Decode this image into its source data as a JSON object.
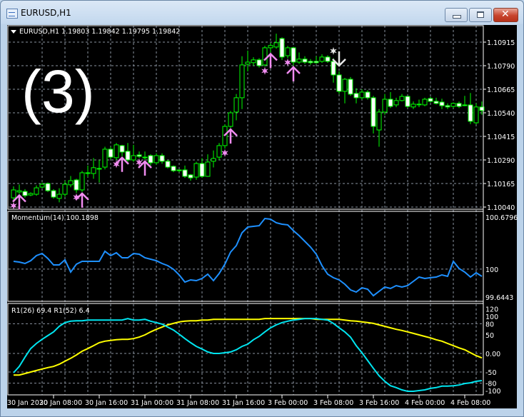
{
  "window": {
    "title": "EURUSD,H1",
    "buttons": {
      "minimize": "minimize",
      "maximize": "maximize",
      "close": "✕"
    }
  },
  "overlay_text": "(3)",
  "colors": {
    "background": "#000000",
    "candle_outline": "#00ff00",
    "bear_body": "#ffffff",
    "bull_body": "#000000",
    "grid": "#8a93a0",
    "signal_buy": "#f08cf0",
    "signal_sell": "#e8e8e8",
    "momentum": "#1e90ff",
    "r1_26": "#00e5f0",
    "r1_52": "#ffff00"
  },
  "chart_data": [
    {
      "type": "candlestick",
      "title": "EURUSD,H1  1.19803 1.19842 1.19795 1.19842",
      "y_ticks": [
        "1.10915",
        "1.10790",
        "1.10665",
        "1.10540",
        "1.10415",
        "1.10290",
        "1.10165",
        "1.10040"
      ],
      "ylim": [
        1.10015,
        1.1101
      ],
      "grid": true,
      "x_tick_labels": [
        "30 Jan 2020",
        "30 Jan 08:00",
        "30 Jan 16:00",
        "31 Jan 00:00",
        "31 Jan 08:00",
        "31 Jan 16:00",
        "3 Feb 00:00",
        "3 Feb 08:00",
        "3 Feb 16:00",
        "4 Feb 00:00",
        "4 Feb 08:00"
      ],
      "x_tick_bar_index": [
        -1,
        7,
        15,
        23,
        31,
        39,
        47,
        55,
        63,
        71,
        79
      ],
      "open": [
        1.10089,
        1.1012,
        1.10123,
        1.10104,
        1.10108,
        1.10146,
        1.10165,
        1.10127,
        1.10086,
        1.10108,
        1.10158,
        1.10184,
        1.10131,
        1.10222,
        1.10218,
        1.10245,
        1.10252,
        1.10347,
        1.10302,
        1.10366,
        1.10336,
        1.1029,
        1.10317,
        1.10305,
        1.10313,
        1.10275,
        1.10313,
        1.10283,
        1.10256,
        1.10237,
        1.10237,
        1.10211,
        1.10199,
        1.10271,
        1.10203,
        1.10283,
        1.10305,
        1.10366,
        1.10468,
        1.10544,
        1.1062,
        1.10798,
        1.10806,
        1.10821,
        1.10794,
        1.10885,
        1.10889,
        1.10934,
        1.10843,
        1.10885,
        1.10809,
        1.10825,
        1.10813,
        1.10813,
        1.10813,
        1.10836,
        1.10813,
        1.10741,
        1.10654,
        1.10718,
        1.10643,
        1.1062,
        1.1065,
        1.1062,
        1.10449,
        1.10544,
        1.10612,
        1.10582,
        1.10605,
        1.10627,
        1.10571,
        1.10586,
        1.10582,
        1.10616,
        1.10601,
        1.10597,
        1.10578,
        1.10574,
        1.1059,
        1.10582,
        1.10582,
        1.10487,
        1.10571
      ],
      "high": [
        1.1015,
        1.1016,
        1.10135,
        1.10118,
        1.10155,
        1.1017,
        1.1017,
        1.10135,
        1.1014,
        1.1018,
        1.10205,
        1.1019,
        1.10232,
        1.1026,
        1.103,
        1.1029,
        1.1036,
        1.1036,
        1.1038,
        1.1037,
        1.1038,
        1.1037,
        1.10335,
        1.10335,
        1.1032,
        1.10325,
        1.10325,
        1.1029,
        1.1026,
        1.1024,
        1.1026,
        1.10215,
        1.1028,
        1.103,
        1.1032,
        1.1034,
        1.1038,
        1.1048,
        1.1055,
        1.1064,
        1.1084,
        1.1087,
        1.10835,
        1.1083,
        1.10895,
        1.1091,
        1.1096,
        1.1094,
        1.10895,
        1.1089,
        1.1086,
        1.1084,
        1.10825,
        1.1084,
        1.1085,
        1.10845,
        1.1083,
        1.1076,
        1.10725,
        1.1073,
        1.1067,
        1.10665,
        1.1066,
        1.1063,
        1.1056,
        1.1064,
        1.1065,
        1.1062,
        1.1064,
        1.1063,
        1.106,
        1.1061,
        1.1062,
        1.10625,
        1.1062,
        1.10615,
        1.1059,
        1.10595,
        1.106,
        1.1063,
        1.10645,
        1.1059,
        1.106
      ],
      "low": [
        1.1007,
        1.1011,
        1.1009,
        1.10098,
        1.101,
        1.1014,
        1.1012,
        1.10085,
        1.10065,
        1.10095,
        1.10145,
        1.10115,
        1.1012,
        1.102,
        1.1019,
        1.1017,
        1.1024,
        1.10295,
        1.1029,
        1.1031,
        1.1028,
        1.1028,
        1.103,
        1.1029,
        1.1026,
        1.10265,
        1.1027,
        1.10245,
        1.10225,
        1.10225,
        1.10195,
        1.1018,
        1.10185,
        1.10195,
        1.102,
        1.1025,
        1.1029,
        1.1035,
        1.1046,
        1.105,
        1.1056,
        1.1076,
        1.1079,
        1.1078,
        1.10785,
        1.1086,
        1.1088,
        1.1082,
        1.1083,
        1.1079,
        1.108,
        1.108,
        1.10795,
        1.108,
        1.10805,
        1.10805,
        1.107,
        1.1064,
        1.1059,
        1.1063,
        1.1059,
        1.1061,
        1.1061,
        1.1043,
        1.1036,
        1.1053,
        1.10565,
        1.1057,
        1.106,
        1.10565,
        1.1056,
        1.1057,
        1.10575,
        1.10595,
        1.10585,
        1.1056,
        1.1056,
        1.10565,
        1.10565,
        1.10575,
        1.1048,
        1.1048,
        1.1053
      ],
      "close": [
        1.10131,
        1.10127,
        1.10101,
        1.10112,
        1.10142,
        1.10161,
        1.10127,
        1.10093,
        1.10108,
        1.10161,
        1.1018,
        1.10131,
        1.10222,
        1.10222,
        1.10249,
        1.10245,
        1.10347,
        1.10305,
        1.1037,
        1.10332,
        1.1029,
        1.10313,
        1.10309,
        1.10305,
        1.10275,
        1.10313,
        1.10283,
        1.10252,
        1.10233,
        1.10233,
        1.10203,
        1.10195,
        1.10271,
        1.10203,
        1.10279,
        1.10298,
        1.10366,
        1.10468,
        1.1054,
        1.1062,
        1.10794,
        1.10809,
        1.10821,
        1.1079,
        1.10885,
        1.10897,
        1.10912,
        1.10836,
        1.10885,
        1.10809,
        1.10825,
        1.10809,
        1.10806,
        1.10806,
        1.10836,
        1.10813,
        1.10741,
        1.10654,
        1.10718,
        1.10639,
        1.1062,
        1.1065,
        1.1062,
        1.10468,
        1.10544,
        1.10612,
        1.10574,
        1.10605,
        1.10627,
        1.10574,
        1.10586,
        1.10586,
        1.10612,
        1.10601,
        1.1059,
        1.10578,
        1.10571,
        1.1059,
        1.10574,
        1.10578,
        1.10495,
        1.10571,
        1.10552
      ],
      "signals": {
        "buy_arrow_bars": [
          1,
          12,
          19,
          23,
          38,
          45,
          49
        ],
        "buy_star_bars": [
          0,
          11,
          18,
          22,
          37,
          44,
          48
        ],
        "sell_arrow_bars": [
          57
        ],
        "sell_star_bars": [
          56
        ]
      }
    },
    {
      "type": "line",
      "title": "Momentum(14) 100.1898",
      "y_ticks": [
        "100.6796",
        "100",
        "99.6443"
      ],
      "ylim": [
        99.6443,
        100.6796
      ],
      "grid": true,
      "values": [
        100.098,
        100.089,
        100.071,
        100.107,
        100.171,
        100.198,
        100.135,
        100.053,
        100.053,
        100.117,
        99.962,
        100.062,
        100.098,
        100.098,
        100.098,
        100.098,
        100.226,
        100.171,
        100.207,
        100.144,
        100.144,
        100.198,
        100.189,
        100.144,
        100.126,
        100.107,
        100.071,
        100.044,
        99.998,
        99.926,
        99.835,
        99.862,
        99.853,
        99.88,
        99.935,
        99.853,
        99.944,
        100.062,
        100.216,
        100.298,
        100.462,
        100.534,
        100.543,
        100.552,
        100.643,
        100.634,
        100.589,
        100.571,
        100.562,
        100.489,
        100.425,
        100.353,
        100.28,
        100.189,
        100.044,
        99.935,
        99.89,
        99.862,
        99.808,
        99.735,
        99.708,
        99.762,
        99.744,
        99.662,
        99.717,
        99.771,
        99.753,
        99.79,
        99.771,
        99.79,
        99.844,
        99.899,
        99.88,
        99.89,
        99.899,
        99.926,
        99.908,
        100.098,
        100.008,
        99.962,
        99.899,
        99.953,
        99.908
      ]
    },
    {
      "type": "line",
      "title": "R1(26) 69.4  R1(52) 6.4",
      "y_ticks": [
        "120",
        "100",
        "80",
        "50",
        "0.00",
        "-50",
        "-80",
        "-100"
      ],
      "y_tick_values": [
        120,
        100,
        80,
        50,
        0,
        -50,
        -80,
        -100
      ],
      "ylim": [
        -111,
        120
      ],
      "grid": true,
      "series": [
        {
          "name": "R1(26)",
          "values": [
            -52,
            -35,
            -10,
            13,
            27,
            38,
            48,
            58,
            73,
            83,
            87,
            88,
            88,
            90,
            90,
            90,
            90,
            90,
            90,
            90,
            94,
            90,
            90,
            92,
            87,
            83,
            79,
            71,
            63,
            52,
            40,
            29,
            19,
            12,
            4,
            0,
            0,
            2,
            4,
            10,
            19,
            25,
            37,
            46,
            58,
            69,
            77,
            83,
            87,
            90,
            92,
            94,
            94,
            94,
            92,
            90,
            81,
            69,
            58,
            44,
            21,
            2,
            -19,
            -40,
            -60,
            -75,
            -87,
            -92,
            -98,
            -102,
            -102,
            -100,
            -98,
            -94,
            -92,
            -88,
            -88,
            -87,
            -85,
            -81,
            -79,
            -75,
            -73
          ]
        },
        {
          "name": "R1(52)",
          "values": [
            -58,
            -58,
            -54,
            -50,
            -46,
            -42,
            -38,
            -35,
            -29,
            -21,
            -13,
            -4,
            6,
            13,
            21,
            29,
            33,
            35,
            37,
            38,
            38,
            40,
            44,
            50,
            58,
            65,
            71,
            77,
            81,
            85,
            87,
            88,
            88,
            90,
            90,
            92,
            92,
            92,
            92,
            92,
            92,
            92,
            92,
            92,
            94,
            94,
            94,
            94,
            94,
            94,
            94,
            94,
            94,
            92,
            92,
            92,
            92,
            92,
            90,
            88,
            87,
            85,
            83,
            81,
            77,
            73,
            69,
            65,
            62,
            58,
            54,
            50,
            46,
            42,
            37,
            33,
            27,
            21,
            15,
            10,
            2,
            -6,
            -12
          ]
        }
      ]
    }
  ]
}
